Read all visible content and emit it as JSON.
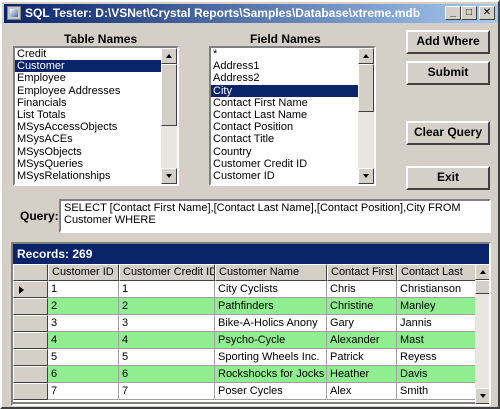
{
  "window": {
    "title": "SQL Tester: D:\\VSNet\\Crystal Reports\\Samples\\Database\\xtreme.mdb",
    "minimize_glyph": "_",
    "maximize_glyph": "□",
    "close_glyph": "✕"
  },
  "tables": {
    "label": "Table Names",
    "items": [
      "Credit",
      "Customer",
      "Employee",
      "Employee Addresses",
      "Financials",
      "List Totals",
      "MSysAccessObjects",
      "MSysACEs",
      "MSysObjects",
      "MSysQueries",
      "MSysRelationships"
    ],
    "selected_index": 1
  },
  "fields": {
    "label": "Field Names",
    "items": [
      "*",
      "Address1",
      "Address2",
      "City",
      "Contact First Name",
      "Contact Last Name",
      "Contact Position",
      "Contact Title",
      "Country",
      "Customer Credit ID",
      "Customer ID"
    ],
    "selected_index": 3
  },
  "buttons": {
    "add_where": "Add Where",
    "submit": "Submit",
    "clear_query": "Clear Query",
    "exit": "Exit"
  },
  "query": {
    "label": "Query:",
    "text": "SELECT [Contact First Name],[Contact Last Name],[Contact Position],City FROM Customer WHERE"
  },
  "records": {
    "caption": "Records: 269",
    "columns": [
      "Customer ID",
      "Customer Credit ID",
      "Customer Name",
      "Contact First",
      "Contact Last"
    ],
    "rows": [
      [
        "1",
        "1",
        "City Cyclists",
        "Chris",
        "Christianson"
      ],
      [
        "2",
        "2",
        "Pathfinders",
        "Christine",
        "Manley"
      ],
      [
        "3",
        "3",
        "Bike-A-Holics Anony",
        "Gary",
        "Jannis"
      ],
      [
        "4",
        "4",
        "Psycho-Cycle",
        "Alexander",
        "Mast"
      ],
      [
        "5",
        "5",
        "Sporting Wheels Inc.",
        "Patrick",
        "Reyess"
      ],
      [
        "6",
        "6",
        "Rockshocks for Jocks",
        "Heather",
        "Davis"
      ],
      [
        "7",
        "7",
        "Poser Cycles",
        "Alex",
        "Smith"
      ]
    ],
    "current_row_index": 0
  },
  "colors": {
    "titlebar_start": "#0a246a",
    "titlebar_end": "#a6caf0",
    "selection": "#0a246a",
    "alt_row": "#90ee90",
    "window_face": "#d4d0c8"
  }
}
